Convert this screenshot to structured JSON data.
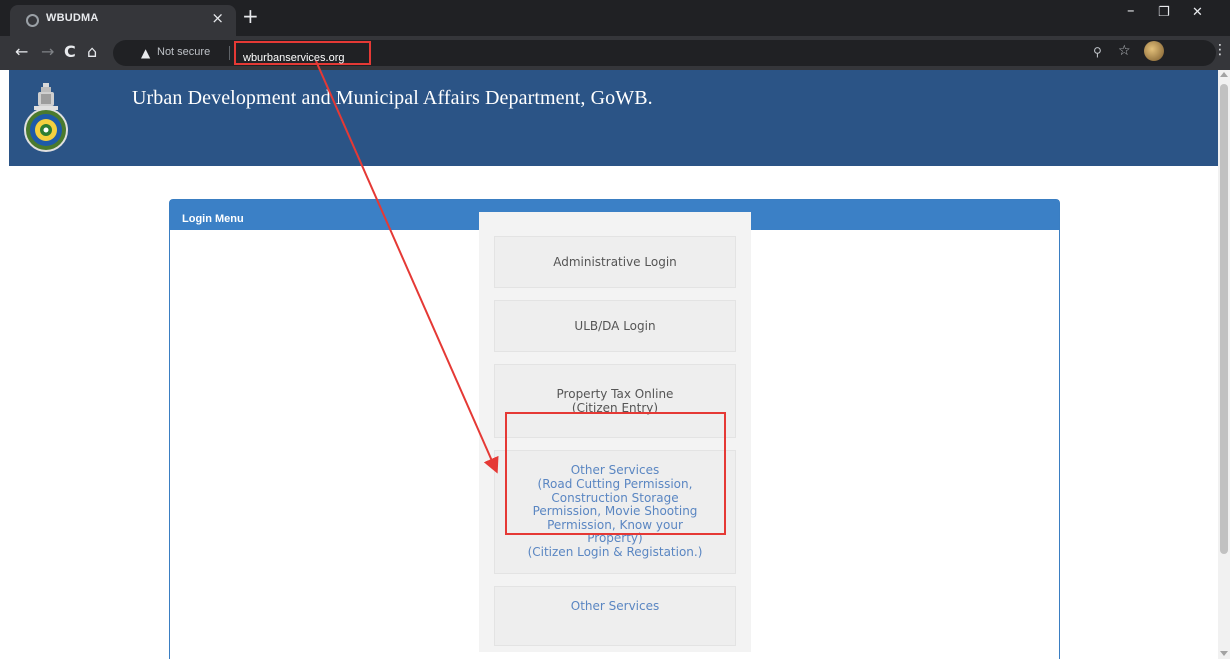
{
  "browser": {
    "tab_title": "WBUDMA",
    "tab_close": "×",
    "new_tab": "+",
    "window_controls": {
      "minimize": "–",
      "maximize": "❐",
      "close": "✕"
    },
    "nav": {
      "back": "←",
      "forward": "→",
      "reload": "C",
      "home": "⌂"
    },
    "security_warning": "Not secure",
    "url": "wburbanservices.org",
    "icons": [
      "zoom-icon",
      "star-icon",
      "profile-avatar",
      "menu-icon"
    ]
  },
  "header": {
    "title": "Urban Development and Municipal Affairs Department, GoWB.",
    "background_color": "#2b5486"
  },
  "login_panel": {
    "heading": "Login Menu",
    "heading_color": "#3b80c6",
    "buttons": [
      {
        "label": "Administrative Login"
      },
      {
        "label": "ULB/DA Login"
      },
      {
        "label": "Property Tax Online\n(Citizen Entry)"
      },
      {
        "label": "Other Services\n(Road Cutting Permission,\nConstruction Storage\nPermission, Movie Shooting\nPermission, Know your\nProperty)\n(Citizen Login & Registation.)",
        "highlighted": true
      },
      {
        "label": "Other Services"
      }
    ]
  },
  "annotation": {
    "color": "#e53935"
  }
}
